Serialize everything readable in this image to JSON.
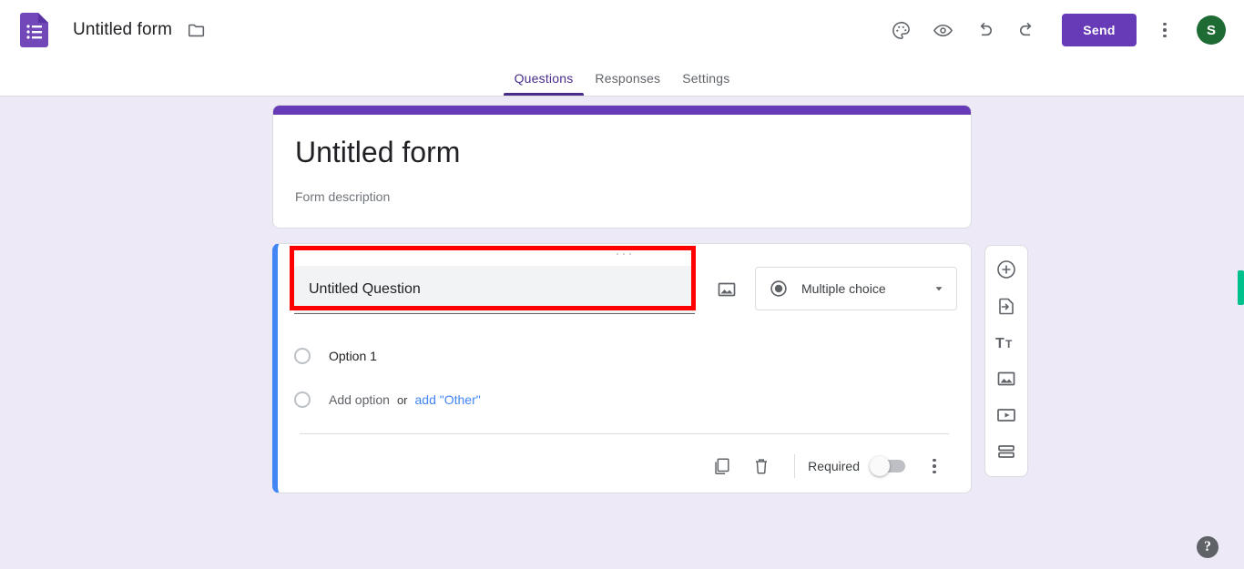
{
  "header": {
    "logo": "forms-logo",
    "doc_title": "Untitled form",
    "folder_icon": "folder-icon",
    "actions": [
      {
        "name": "theme-icon",
        "label": "Customize theme"
      },
      {
        "name": "preview-icon",
        "label": "Preview"
      },
      {
        "name": "undo-icon",
        "label": "Undo"
      },
      {
        "name": "redo-icon",
        "label": "Redo"
      }
    ],
    "send_label": "Send",
    "more_label": "More options",
    "avatar_initial": "S",
    "accent_purple": "#673AB7",
    "avatar_color": "#1E6B33"
  },
  "tabs": [
    {
      "label": "Questions",
      "active": true
    },
    {
      "label": "Responses",
      "active": false
    },
    {
      "label": "Settings",
      "active": false
    }
  ],
  "form": {
    "title": "Untitled form",
    "description": "Form description",
    "accent_color": "#673AB7"
  },
  "question": {
    "title_value": "Untitled Question",
    "title_placeholder": "Question",
    "type_label": "Multiple choice",
    "type_icon": "radio-filled-icon",
    "image_icon": "insert-image-icon",
    "selected_accent": "#4285F4",
    "annotation_color": "#FF0000",
    "options": [
      {
        "label": "Option 1",
        "muted": false
      }
    ],
    "add_option_label": "Add option",
    "or_label": "or",
    "add_other_label": "add \"Other\"",
    "add_other_color": "#4285F4",
    "footer": {
      "duplicate_label": "Duplicate",
      "delete_label": "Delete",
      "required_label": "Required",
      "required_on": false,
      "more_label": "More options"
    }
  },
  "side_toolbar": [
    {
      "name": "add-question-icon",
      "label": "Add question"
    },
    {
      "name": "import-questions-icon",
      "label": "Import questions"
    },
    {
      "name": "add-title-icon",
      "label": "Add title and description"
    },
    {
      "name": "add-image-icon",
      "label": "Add image"
    },
    {
      "name": "add-video-icon",
      "label": "Add video"
    },
    {
      "name": "add-section-icon",
      "label": "Add section"
    }
  ],
  "help": {
    "label": "?"
  },
  "scrollbar": {
    "color": "#00C08B"
  },
  "page_background": "#EDE9F6"
}
